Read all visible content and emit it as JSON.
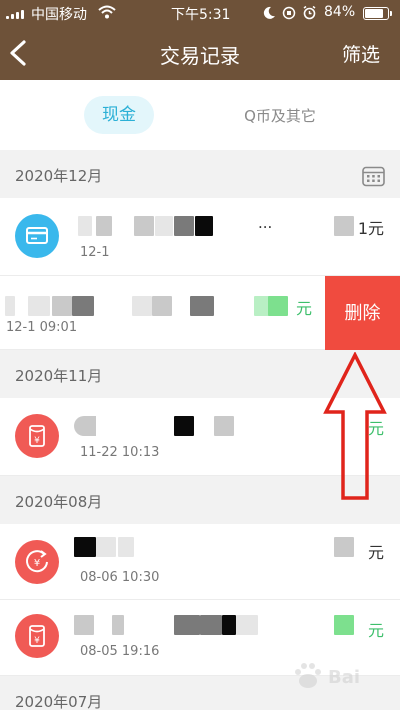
{
  "status_bar": {
    "carrier": "中国移动",
    "time": "下午5:31",
    "battery_percent": 84,
    "battery_label": "84%"
  },
  "nav": {
    "title": "交易记录",
    "filter_label": "筛选"
  },
  "tabs": [
    {
      "label": "现金",
      "active": true
    },
    {
      "label": "Q币及其它",
      "active": false
    }
  ],
  "sections": [
    {
      "header": "2020年12月",
      "rows": [
        {
          "title": "...",
          "time": "12-1",
          "amount": "1元",
          "icon": "card-icon"
        },
        {
          "title": "",
          "time": "12-1 09:01",
          "amount": "元",
          "icon": "none",
          "swiped": true,
          "delete_label": "删除"
        }
      ]
    },
    {
      "header": "2020年11月",
      "rows": [
        {
          "title": "",
          "time": "11-22 10:13",
          "amount": "元",
          "icon": "red-packet-icon"
        }
      ]
    },
    {
      "header": "2020年08月",
      "rows": [
        {
          "title": "",
          "time": "08-06 10:30",
          "amount": "元",
          "icon": "refund-packet-icon"
        },
        {
          "title": "",
          "time": "08-05 19:16",
          "amount": "元",
          "icon": "red-packet-icon"
        }
      ]
    },
    {
      "header": "2020年07月",
      "rows": []
    }
  ],
  "colors": {
    "header_brown": "#6e5239",
    "accent_blue": "#2bb0d6",
    "delete_red": "#f04b3f",
    "icon_red": "#f05a55",
    "card_blue": "#3ab8ec",
    "income_green": "#3dbf6b"
  }
}
